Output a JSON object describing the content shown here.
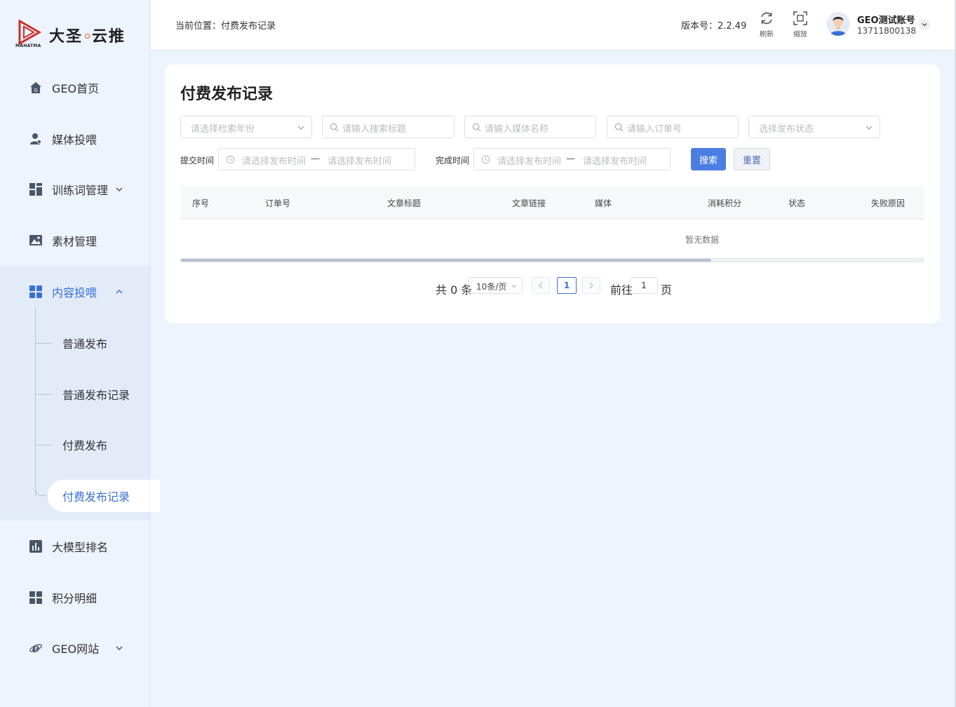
{
  "brand": {
    "name": "大圣",
    "name2": "云推",
    "subtitle": "MAHATMA"
  },
  "sidebar": {
    "items": [
      {
        "label": "GEO首页",
        "icon": "home-icon"
      },
      {
        "label": "媒体投喂",
        "icon": "user-icon"
      },
      {
        "label": "训练词管理",
        "icon": "grid-icon",
        "expandable": true
      },
      {
        "label": "素材管理",
        "icon": "image-icon"
      },
      {
        "label": "内容投喂",
        "icon": "grid-icon",
        "expandable": true,
        "expanded": true
      },
      {
        "label": "大模型排名",
        "icon": "bar-chart-icon"
      },
      {
        "label": "积分明细",
        "icon": "grid-icon"
      },
      {
        "label": "GEO网站",
        "icon": "ie-icon",
        "expandable": true
      }
    ],
    "sub_items": [
      {
        "label": "普通发布"
      },
      {
        "label": "普通发布记录"
      },
      {
        "label": "付费发布"
      },
      {
        "label": "付费发布记录",
        "active": true
      }
    ]
  },
  "header": {
    "breadcrumb": "当前位置：付费发布记录",
    "version": "版本号：2.2.49",
    "refresh_label": "刷新",
    "zoom_label": "缩放",
    "user_name": "GEO测试账号",
    "user_phone": "13711800138"
  },
  "main": {
    "title": "付费发布记录",
    "filters": {
      "year_placeholder": "请选择检索年份",
      "title_placeholder": "请输入搜索标题",
      "media_placeholder": "请输入媒体名称",
      "order_placeholder": "请输入订单号",
      "status_placeholder": "选择发布状态",
      "submit_time_label": "提交时间",
      "finish_time_label": "完成时间",
      "time_placeholder": "请选择发布时间",
      "range_separator": "—",
      "search_label": "搜索",
      "reset_label": "重置"
    },
    "table": {
      "columns": [
        "序号",
        "订单号",
        "文章标题",
        "文章链接",
        "媒体",
        "消耗积分",
        "状态",
        "失败原因"
      ],
      "rows": [],
      "empty_text": "暂无数据"
    },
    "pagination": {
      "total_text": "共 0 条",
      "page_size": "10条/页",
      "current_page": "1",
      "goto_prefix": "前往",
      "goto_value": "1",
      "goto_suffix": "页"
    }
  },
  "colors": {
    "accent": "#3a6fd8",
    "primary_button": "#4a7ee0",
    "background": "#eef4fd"
  }
}
